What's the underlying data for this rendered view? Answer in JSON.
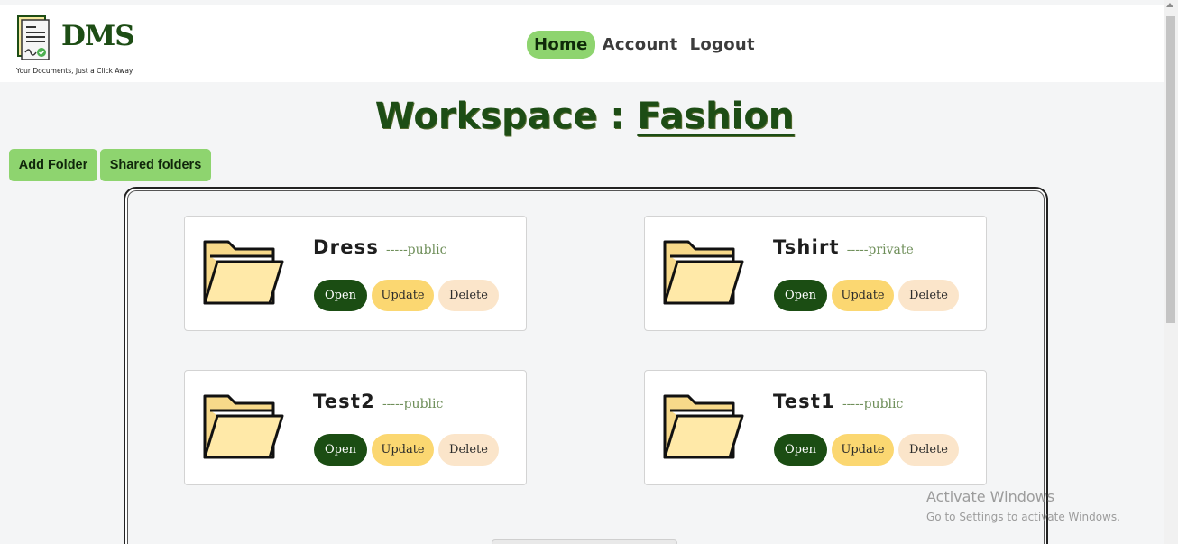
{
  "header": {
    "logo_text": "DMS",
    "tagline": "Your Documents, Just a Click Away",
    "nav": [
      {
        "label": "Home",
        "active": true
      },
      {
        "label": "Account",
        "active": false
      },
      {
        "label": "Logout",
        "active": false
      }
    ]
  },
  "workspace": {
    "prefix": "Workspace : ",
    "name": "Fashion"
  },
  "actions": {
    "add_folder": "Add Folder",
    "shared_folders": "Shared folders"
  },
  "folders": [
    {
      "name": "Dress",
      "visibility": "-----public"
    },
    {
      "name": "Tshirt",
      "visibility": "-----private"
    },
    {
      "name": "Test2",
      "visibility": "-----public"
    },
    {
      "name": "Test1",
      "visibility": "-----public"
    }
  ],
  "folder_buttons": {
    "open": "Open",
    "update": "Update",
    "delete": "Delete"
  },
  "watermark": {
    "line1": "Activate Windows",
    "line2": "Go to Settings to activate Windows."
  },
  "colors": {
    "brand_green": "#1d4d15",
    "nav_active": "#8ed46f",
    "open_btn": "#1b4d13",
    "update_btn": "#fbd771",
    "delete_btn": "#fbe5ca"
  }
}
